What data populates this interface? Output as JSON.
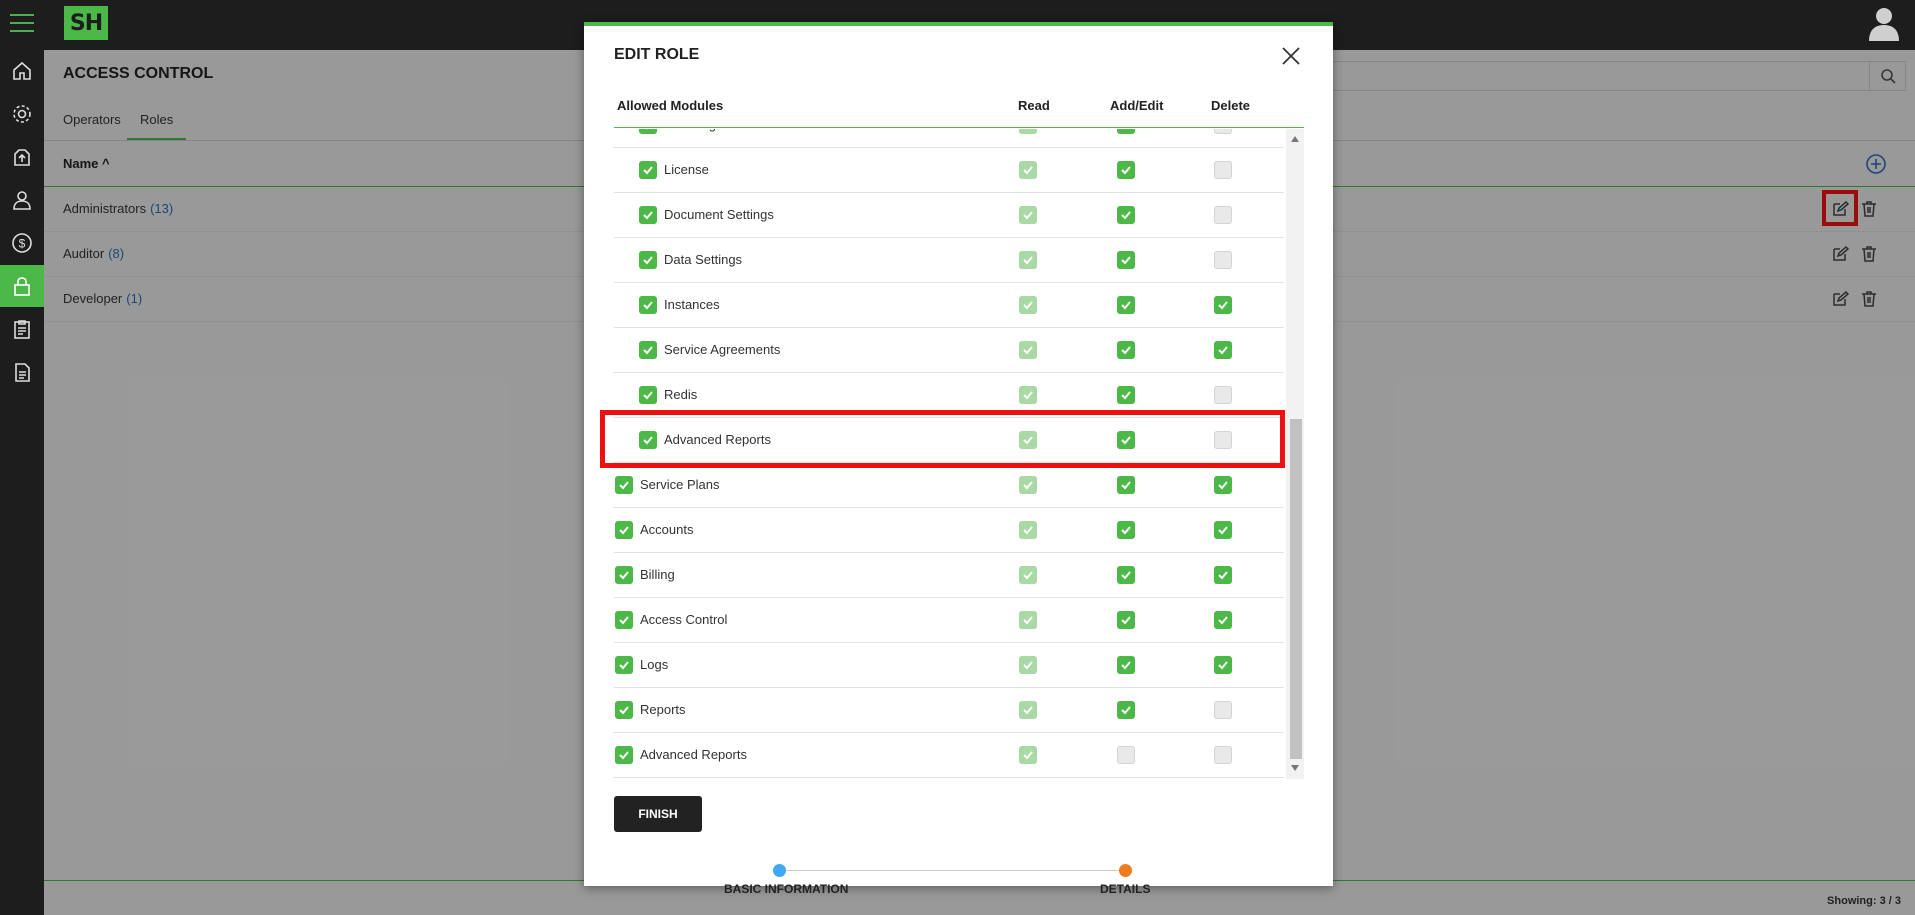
{
  "page": {
    "title": "ACCESS CONTROL",
    "tabs": [
      "Operators",
      "Roles"
    ],
    "active_tab": "Roles",
    "column_name": "Name",
    "roles": [
      {
        "name": "Administrators",
        "count": "(13)"
      },
      {
        "name": "Auditor",
        "count": "(8)"
      },
      {
        "name": "Developer",
        "count": "(1)"
      }
    ],
    "showing": "Showing: 3 / 3"
  },
  "logo": "SH",
  "modal": {
    "title": "EDIT ROLE",
    "headers": {
      "module": "Allowed Modules",
      "read": "Read",
      "add_edit": "Add/Edit",
      "delete": "Delete"
    },
    "rows": [
      {
        "label": "Branding",
        "indent": true,
        "checked": true,
        "read": true,
        "add_edit": true,
        "delete": false
      },
      {
        "label": "License",
        "indent": true,
        "checked": true,
        "read": true,
        "add_edit": true,
        "delete": false
      },
      {
        "label": "Document Settings",
        "indent": true,
        "checked": true,
        "read": true,
        "add_edit": true,
        "delete": false
      },
      {
        "label": "Data Settings",
        "indent": true,
        "checked": true,
        "read": true,
        "add_edit": true,
        "delete": false
      },
      {
        "label": "Instances",
        "indent": true,
        "checked": true,
        "read": true,
        "add_edit": true,
        "delete": true
      },
      {
        "label": "Service Agreements",
        "indent": true,
        "checked": true,
        "read": true,
        "add_edit": true,
        "delete": true
      },
      {
        "label": "Redis",
        "indent": true,
        "checked": true,
        "read": true,
        "add_edit": true,
        "delete": false
      },
      {
        "label": "Advanced Reports",
        "indent": true,
        "checked": true,
        "read": true,
        "add_edit": true,
        "delete": false
      },
      {
        "label": "Service Plans",
        "indent": false,
        "checked": true,
        "read": true,
        "add_edit": true,
        "delete": true
      },
      {
        "label": "Accounts",
        "indent": false,
        "checked": true,
        "read": true,
        "add_edit": true,
        "delete": true
      },
      {
        "label": "Billing",
        "indent": false,
        "checked": true,
        "read": true,
        "add_edit": true,
        "delete": true
      },
      {
        "label": "Access Control",
        "indent": false,
        "checked": true,
        "read": true,
        "add_edit": true,
        "delete": true
      },
      {
        "label": "Logs",
        "indent": false,
        "checked": true,
        "read": true,
        "add_edit": true,
        "delete": true
      },
      {
        "label": "Reports",
        "indent": false,
        "checked": true,
        "read": true,
        "add_edit": true,
        "delete": false
      },
      {
        "label": "Advanced Reports",
        "indent": false,
        "checked": true,
        "read": true,
        "add_edit": false,
        "delete": false
      }
    ],
    "finish_label": "FINISH",
    "steps": [
      "BASIC INFORMATION",
      "DETAILS"
    ]
  },
  "colors": {
    "accent": "#4cb847",
    "step1": "#3fa9f5",
    "step2": "#f07c22",
    "highlight": "#ee1111",
    "link": "#2a6ebb"
  },
  "icons": [
    "menu-icon",
    "user-avatar-icon",
    "home-icon",
    "gear-icon",
    "upload-icon",
    "operator-icon",
    "dollar-icon",
    "lock-icon",
    "clipboard-icon",
    "document-icon",
    "search-icon",
    "add-circle-icon",
    "edit-icon",
    "trash-icon",
    "close-icon",
    "check-icon"
  ]
}
